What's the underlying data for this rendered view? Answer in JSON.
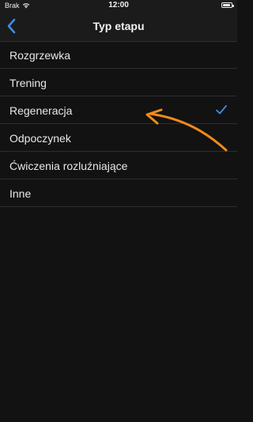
{
  "status_bar": {
    "carrier": "Brak",
    "time": "12:00",
    "battery_level": 0.9
  },
  "nav": {
    "title": "Typ etapu",
    "back_icon": "chevron-left-icon"
  },
  "list": {
    "items": [
      {
        "label": "Rozgrzewka",
        "selected": false
      },
      {
        "label": "Trening",
        "selected": false
      },
      {
        "label": "Regeneracja",
        "selected": true
      },
      {
        "label": "Odpoczynek",
        "selected": false
      },
      {
        "label": "Ćwiczenia rozluźniające",
        "selected": false
      },
      {
        "label": "Inne",
        "selected": false
      }
    ]
  },
  "colors": {
    "accent": "#3a8ee6",
    "annotation": "#f08a1c",
    "background": "#121212",
    "divider": "#2e2e2e"
  }
}
